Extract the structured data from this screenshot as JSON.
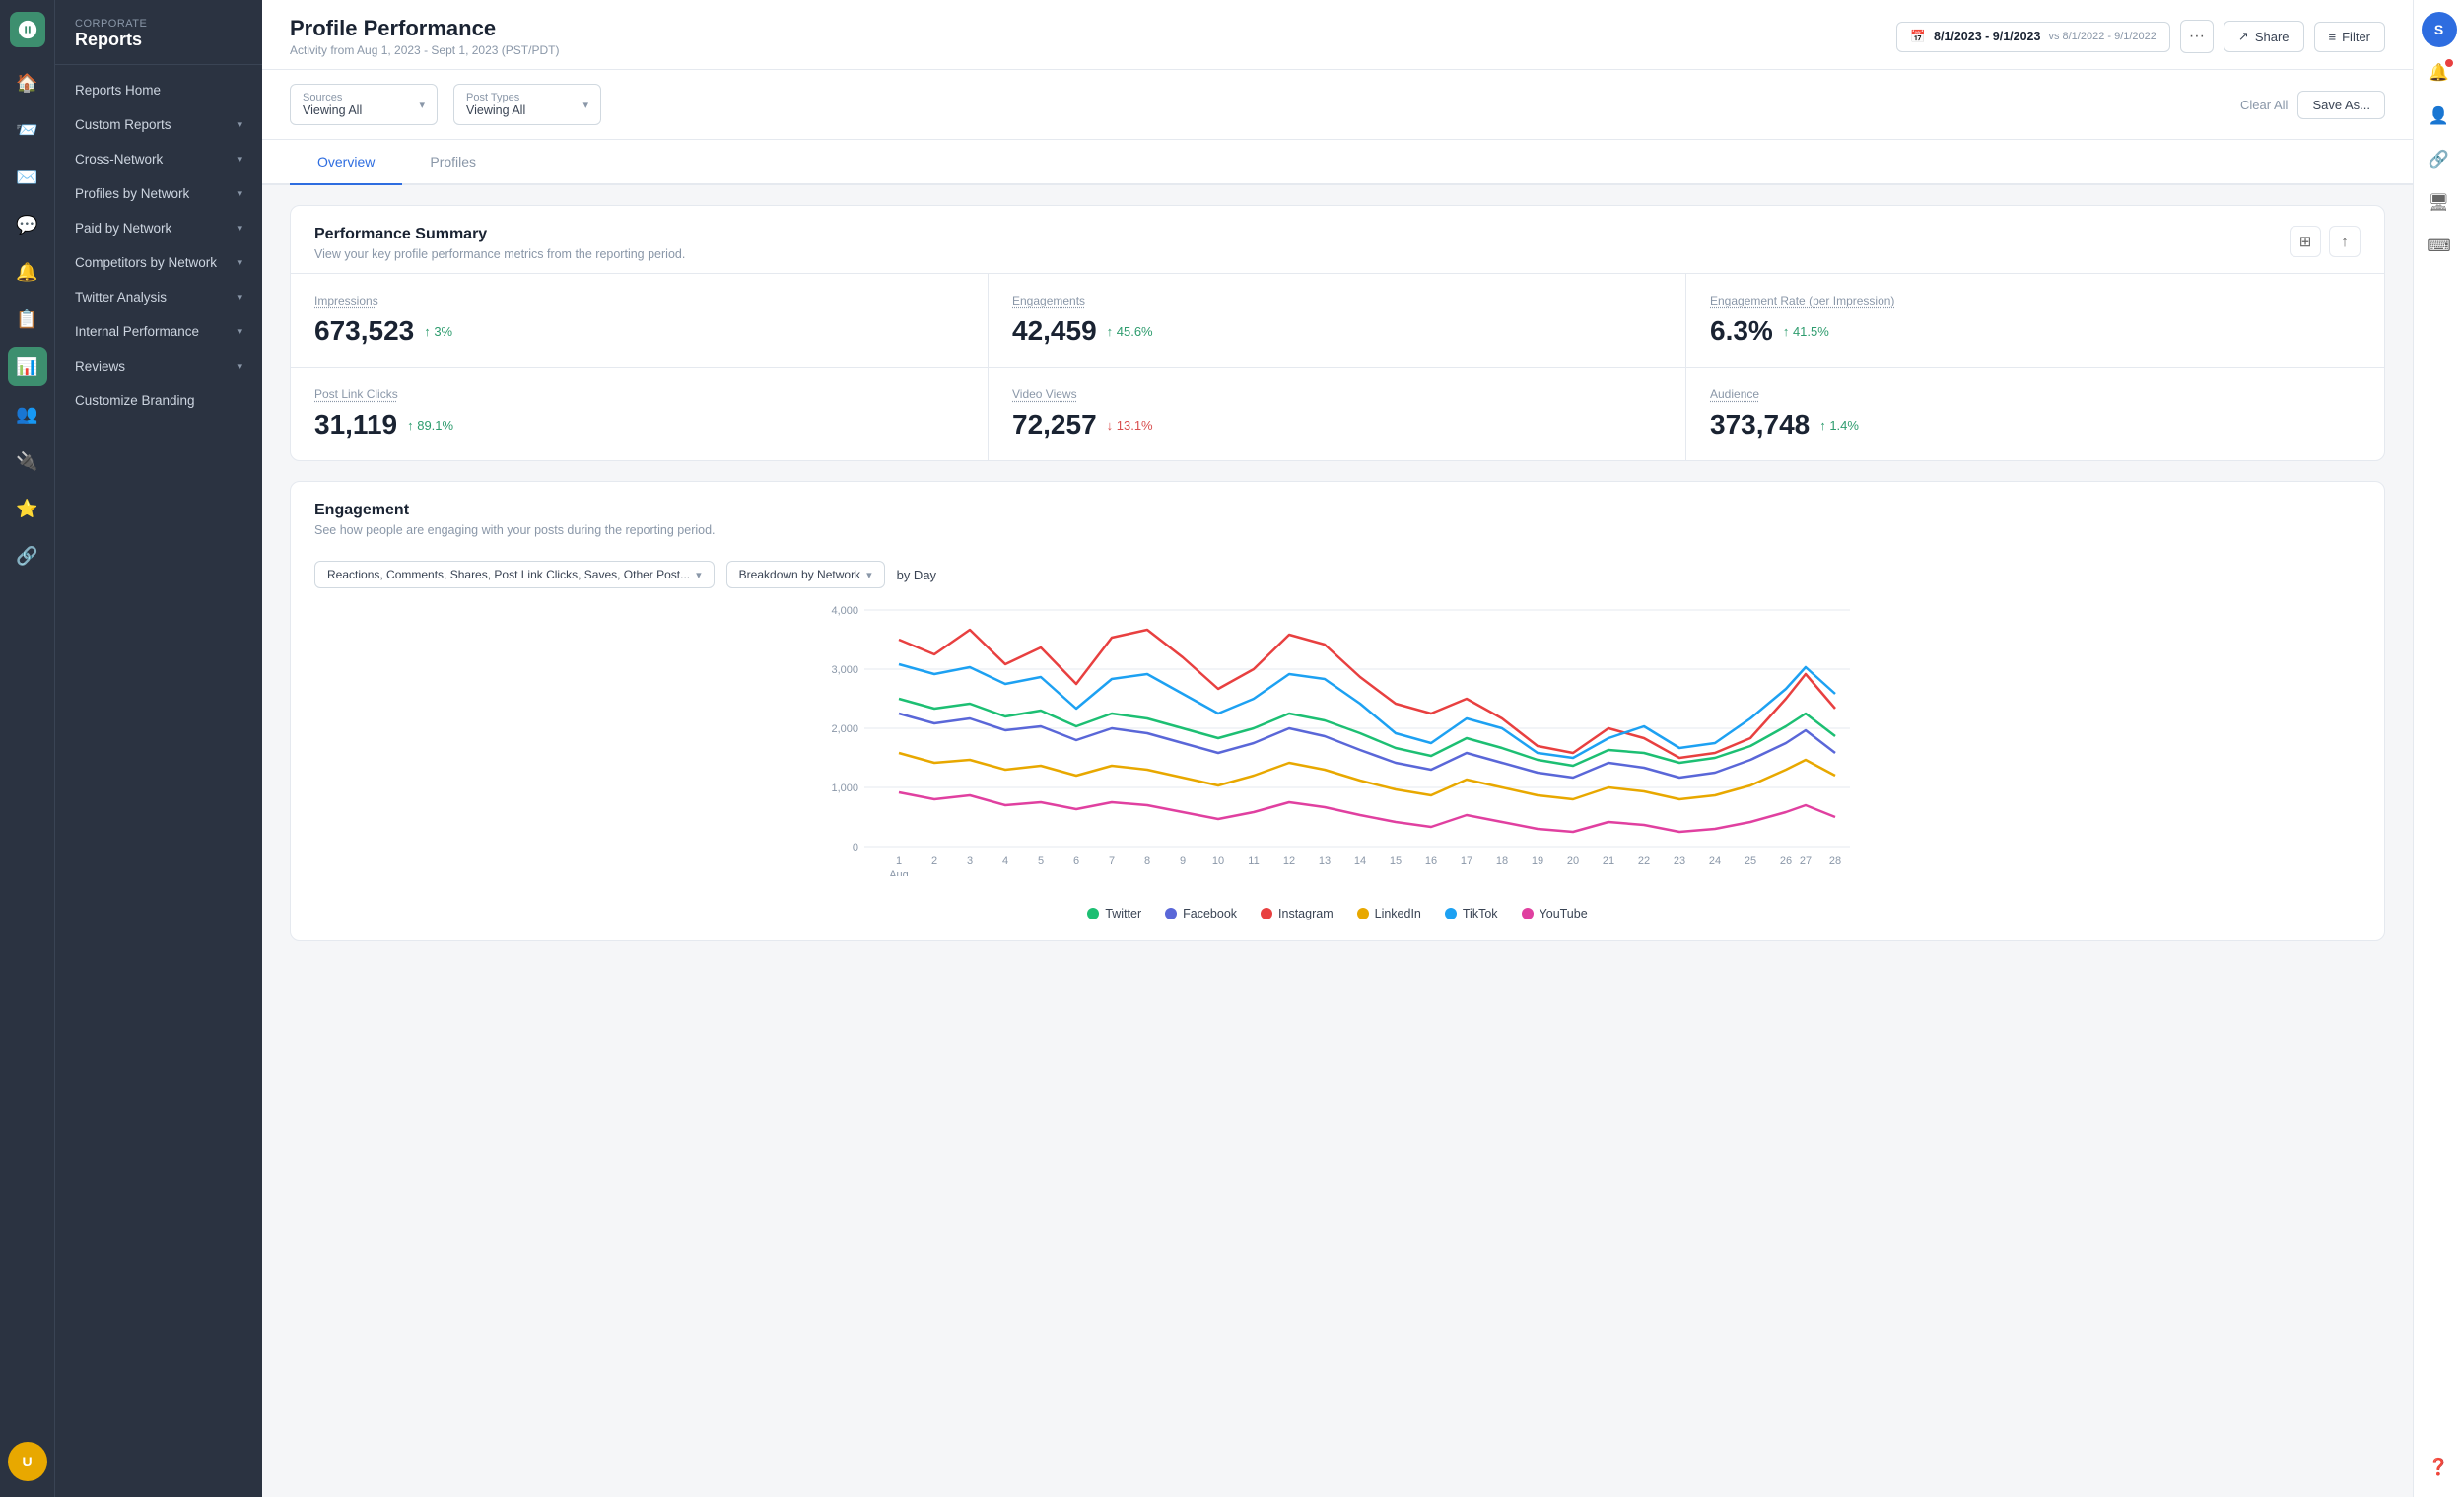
{
  "brand": {
    "sub": "Corporate",
    "title": "Reports"
  },
  "sidebar": {
    "items": [
      {
        "id": "reports-home",
        "label": "Reports Home",
        "hasChevron": false
      },
      {
        "id": "custom-reports",
        "label": "Custom Reports",
        "hasChevron": true
      },
      {
        "id": "cross-network",
        "label": "Cross-Network",
        "hasChevron": true
      },
      {
        "id": "profiles-by-network",
        "label": "Profiles by Network",
        "hasChevron": true
      },
      {
        "id": "paid-by-network",
        "label": "Paid by Network",
        "hasChevron": true
      },
      {
        "id": "competitors-by-network",
        "label": "Competitors by Network",
        "hasChevron": true
      },
      {
        "id": "twitter-analysis",
        "label": "Twitter Analysis",
        "hasChevron": true
      },
      {
        "id": "internal-performance",
        "label": "Internal Performance",
        "hasChevron": true
      },
      {
        "id": "reviews",
        "label": "Reviews",
        "hasChevron": true
      },
      {
        "id": "customize-branding",
        "label": "Customize Branding",
        "hasChevron": false
      }
    ]
  },
  "header": {
    "title": "Profile Performance",
    "subtitle": "Activity from Aug 1, 2023 - Sept 1, 2023 (PST/PDT)",
    "dateRange": "8/1/2023 - 9/1/2023",
    "dateCompare": "vs 8/1/2022 - 9/1/2022",
    "shareLabel": "Share",
    "filterLabel": "Filter"
  },
  "filterBar": {
    "sources": {
      "label": "Sources",
      "value": "Viewing All"
    },
    "postTypes": {
      "label": "Post Types",
      "value": "Viewing All"
    },
    "clearLabel": "Clear All",
    "saveLabel": "Save As..."
  },
  "tabs": [
    {
      "id": "overview",
      "label": "Overview",
      "active": true
    },
    {
      "id": "profiles",
      "label": "Profiles",
      "active": false
    }
  ],
  "performanceSummary": {
    "title": "Performance Summary",
    "subtitle": "View your key profile performance metrics from the reporting period.",
    "metrics": [
      {
        "id": "impressions",
        "label": "Impressions",
        "value": "673,523",
        "change": "↑ 3%",
        "direction": "up"
      },
      {
        "id": "engagements",
        "label": "Engagements",
        "value": "42,459",
        "change": "↑ 45.6%",
        "direction": "up"
      },
      {
        "id": "engagement-rate",
        "label": "Engagement Rate (per Impression)",
        "value": "6.3%",
        "change": "↑ 41.5%",
        "direction": "up"
      },
      {
        "id": "post-link-clicks",
        "label": "Post Link Clicks",
        "value": "31,119",
        "change": "↑ 89.1%",
        "direction": "up"
      },
      {
        "id": "video-views",
        "label": "Video Views",
        "value": "72,257",
        "change": "↓ 13.1%",
        "direction": "down"
      },
      {
        "id": "audience",
        "label": "Audience",
        "value": "373,748",
        "change": "↑ 1.4%",
        "direction": "up"
      }
    ]
  },
  "engagement": {
    "title": "Engagement",
    "subtitle": "See how people are engaging with your posts during the reporting period.",
    "dropdownLabel": "Reactions, Comments, Shares, Post Link Clicks, Saves, Other Post...",
    "breakdownLabel": "Breakdown by Network",
    "byDayLabel": "by Day",
    "yAxisLabels": [
      "4,000",
      "3,000",
      "2,000",
      "1,000",
      "0"
    ],
    "xAxisLabels": [
      "1",
      "2",
      "3",
      "4",
      "5",
      "6",
      "7",
      "8",
      "9",
      "10",
      "11",
      "12",
      "13",
      "14",
      "15",
      "16",
      "17",
      "18",
      "19",
      "20",
      "21",
      "22",
      "23",
      "24",
      "25",
      "26",
      "27",
      "28"
    ],
    "xAxisSubLabel": "Aug",
    "legend": [
      {
        "id": "twitter",
        "label": "Twitter",
        "color": "#1dbf73"
      },
      {
        "id": "facebook",
        "label": "Facebook",
        "color": "#5a67d8"
      },
      {
        "id": "instagram",
        "label": "Instagram",
        "color": "#e84040"
      },
      {
        "id": "linkedin",
        "label": "LinkedIn",
        "color": "#e8a800"
      },
      {
        "id": "tiktok",
        "label": "TikTok",
        "color": "#1da1f2"
      },
      {
        "id": "youtube",
        "label": "YouTube",
        "color": "#e040a0"
      }
    ]
  }
}
